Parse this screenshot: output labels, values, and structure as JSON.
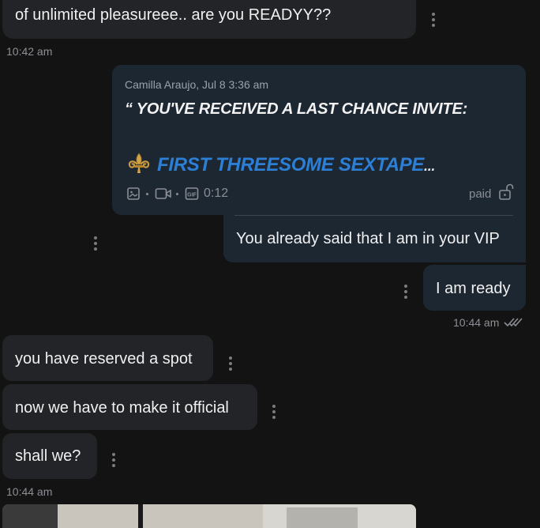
{
  "messages": {
    "incoming_top": {
      "text": "of unlimited pleasureee.. are you READYY??",
      "time": "10:42 am"
    },
    "quote": {
      "author_line": "Camilla Araujo, Jul 8 3:36 am",
      "headline": "“ YOU'VE RECEIVED A LAST CHANCE INVITE:",
      "link_text": "FIRST THREESOME SEXTAPE",
      "ellipsis": "...",
      "duration": "0:12",
      "paid_label": "paid",
      "reply_text": "You already said that I am in your VIP"
    },
    "outgoing_ready": {
      "text": "I am ready",
      "time": "10:44 am"
    },
    "incoming_1": {
      "text": "you have reserved a spot"
    },
    "incoming_2": {
      "text": "now we have to make it official"
    },
    "incoming_3": {
      "text": "shall we?"
    },
    "incoming_time": "10:44 am"
  },
  "icons": {
    "quote_emoji": "fleur-de-lis",
    "media": [
      "image-icon",
      "video-icon",
      "gif-icon"
    ],
    "paid": "unlock-icon",
    "read": "double-check-icon",
    "more": "more-vertical-icon"
  },
  "colors": {
    "link": "#2d7fd6",
    "bubble_out": "#1c2732",
    "bubble_in": "#232427"
  }
}
